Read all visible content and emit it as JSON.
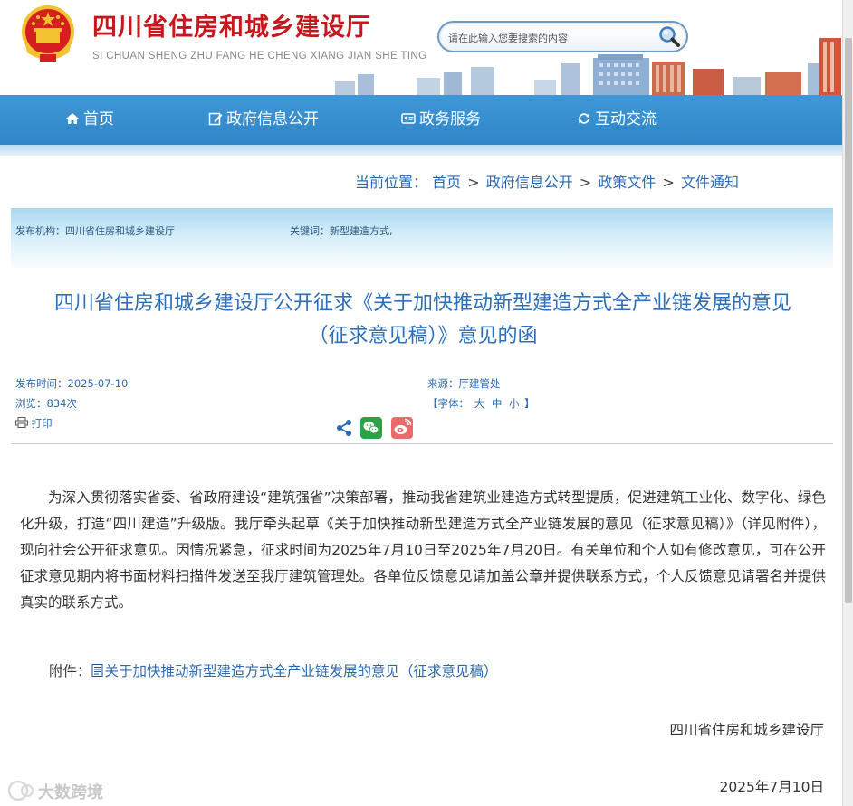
{
  "header": {
    "title": "四川省住房和城乡建设厅",
    "pinyin": "SI CHUAN SHENG ZHU FANG HE CHENG XIANG JIAN SHE TING",
    "search_placeholder": "请在此输入您要搜索的内容"
  },
  "nav": {
    "items": [
      {
        "label": "首页",
        "icon": "home-icon"
      },
      {
        "label": "政府信息公开",
        "icon": "edit-icon"
      },
      {
        "label": "政务服务",
        "icon": "service-icon"
      },
      {
        "label": "互动交流",
        "icon": "interact-icon"
      }
    ]
  },
  "breadcrumb": {
    "prefix": "当前位置：",
    "items": [
      "首页",
      "政府信息公开",
      "政策文件",
      "文件通知"
    ],
    "separator": ">"
  },
  "meta": {
    "publisher_label": "发布机构：",
    "publisher": "四川省住房和城乡建设厅",
    "keywords_label": "关键词：",
    "keywords": "新型建造方式,"
  },
  "article": {
    "title_line1": "四川省住房和城乡建设厅公开征求《关于加快推动新型建造方式全产业链发展的意见",
    "title_line2": "（征求意见稿）》意见的函",
    "publish_time_label": "发布时间：",
    "publish_time": "2025-07-10",
    "views_label": "浏览：",
    "views": "834次",
    "source_label": "来源：",
    "source": "厅建管处",
    "font_size_label_open": "【字体：",
    "font_sizes": [
      "大",
      "中",
      "小"
    ],
    "font_size_label_close": "】",
    "print_label": "打印",
    "body": "为深入贯彻落实省委、省政府建设“建筑强省”决策部署，推动我省建筑业建造方式转型提质，促进建筑工业化、数字化、绿色化升级，打造“四川建造”升级版。我厅牵头起草《关于加快推动新型建造方式全产业链发展的意见（征求意见稿）》（详见附件），现向社会公开征求意见。因情况紧急，征求时间为2025年7月10日至2025年7月20日。有关单位和个人如有修改意见，可在公开征求意见期内将书面材料扫描件发送至我厅建筑管理处。各单位反馈意见请加盖公章并提供联系方式，个人反馈意见请署名并提供真实的联系方式。",
    "attachment_label": "附件：",
    "attachment_link": "关于加快推动新型建造方式全产业链发展的意见（征求意见稿）",
    "signature": "四川省住房和城乡建设厅",
    "sign_date": "2025年7月10日"
  },
  "watermark": "大数跨境",
  "colors": {
    "brand_red": "#c8161d",
    "nav_blue": "#3a92d2",
    "link_blue": "#2a6ab5",
    "title_blue": "#2c6fbb"
  }
}
